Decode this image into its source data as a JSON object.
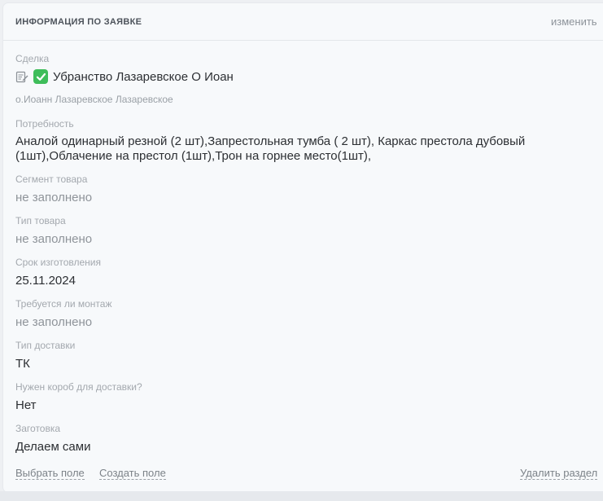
{
  "header": {
    "title": "ИНФОРМАЦИЯ ПО ЗАЯВКЕ",
    "edit_label": "изменить"
  },
  "deal": {
    "label": "Сделка",
    "title": "Убранство Лазаревское О Иоан",
    "subtitle": "о.Иоанн Лазаревское Лазаревское",
    "status_icon": "check-mark-green"
  },
  "fields": [
    {
      "label": "Потребность",
      "value": "Аналой одинарный резной (2 шт),Запрестольная тумба ( 2 шт), Каркас престола дубовый (1шт),Облачение на престол (1шт),Трон на горнее место(1шт),"
    },
    {
      "label": "Сегмент товара",
      "value": "не заполнено"
    },
    {
      "label": "Тип товара",
      "value": "не заполнено"
    },
    {
      "label": "Срок изготовления",
      "value": "25.11.2024"
    },
    {
      "label": "Требуется ли монтаж",
      "value": "не заполнено"
    },
    {
      "label": "Тип доставки",
      "value": "ТК"
    },
    {
      "label": "Нужен короб для доставки?",
      "value": "Нет"
    },
    {
      "label": "Заготовка",
      "value": "Делаем сами"
    }
  ],
  "footer": {
    "select_field": "Выбрать поле",
    "create_field": "Создать поле",
    "delete_section": "Удалить раздел"
  }
}
